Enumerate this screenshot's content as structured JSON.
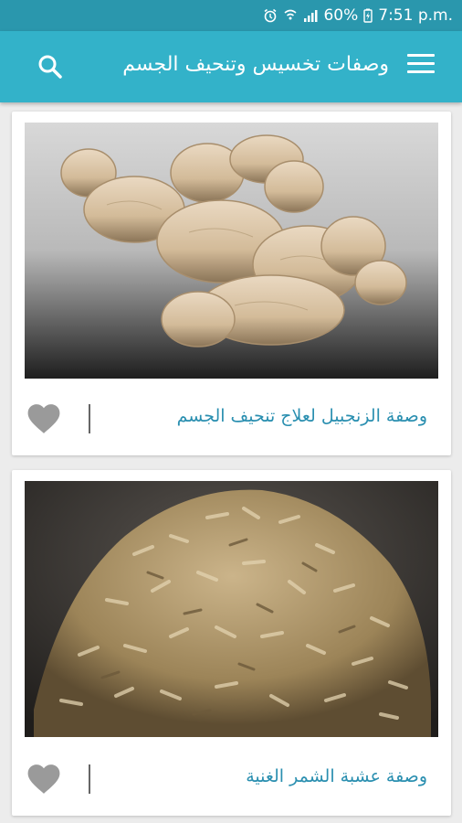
{
  "status_bar": {
    "battery": "60%",
    "time": "7:51 p.m."
  },
  "app_bar": {
    "title": "وصفات تخسيس وتنحيف الجسم",
    "menu_icon": "hamburger-menu-icon",
    "search_icon": "search-icon"
  },
  "recipes": [
    {
      "title": "وصفة الزنجبيل لعلاج تنحيف الجسم",
      "image": "ginger-root",
      "favorite_icon": "heart-icon"
    },
    {
      "title": "وصفة عشبة الشمر الغنية",
      "image": "fennel-seeds",
      "favorite_icon": "heart-icon"
    }
  ],
  "colors": {
    "status_bar": "#2a97ad",
    "app_bar": "#33b2c9",
    "title_text": "#2a8fb0",
    "heart": "#9a9a9a"
  }
}
